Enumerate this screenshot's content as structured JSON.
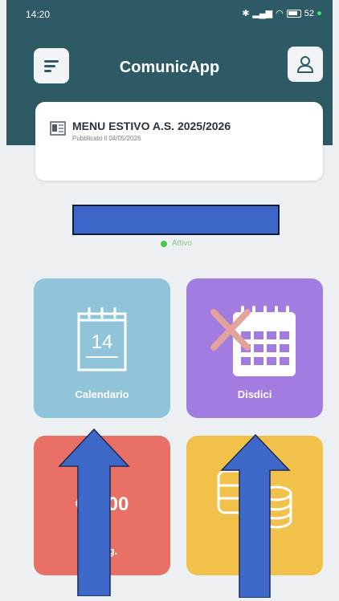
{
  "status_bar": {
    "time": "14:20",
    "battery": "52"
  },
  "header": {
    "title": "ComunicApp",
    "background_color": "#2d5a65"
  },
  "notice": {
    "title": "MENU ESTIVO A.S. 2025/2026",
    "published": "Pubblicato il 04/05/2026",
    "icon": "document-icon"
  },
  "account": {
    "status": "Attivo",
    "status_color": "#4cc54c"
  },
  "tiles": {
    "calendario": {
      "label": "Calendario",
      "day": "14",
      "color": "#8fc4da",
      "icon": "calendar-icon"
    },
    "disdici": {
      "label": "Disdici",
      "color": "#a27ce0",
      "icon": "calendar-cancel-icon"
    },
    "crediti": {
      "amount": "€ 4,00",
      "label": "1 Pag.",
      "color": "#e87065"
    },
    "pagamenti": {
      "label": "Pa nti",
      "color": "#f2c149",
      "icon": "coins-icon"
    }
  },
  "annotations": {
    "arrow_color": "#3f69c8"
  }
}
